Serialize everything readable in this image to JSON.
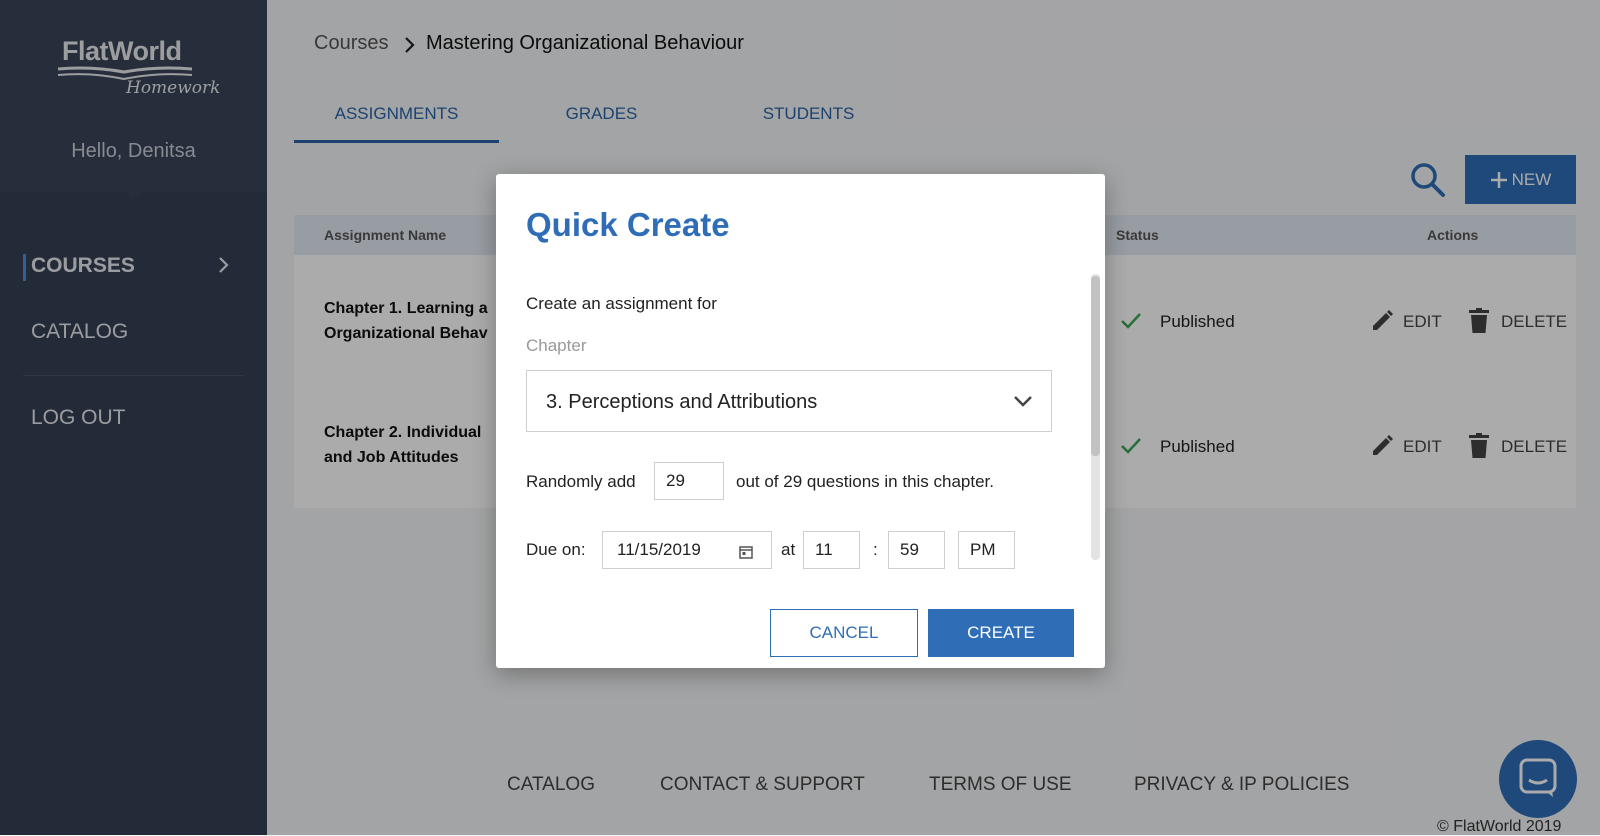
{
  "logo": {
    "name": "FlatWorld",
    "sub": "Homework"
  },
  "sidebar": {
    "greeting": "Hello, Denitsa",
    "items": [
      {
        "label": "COURSES",
        "active": true
      },
      {
        "label": "CATALOG"
      },
      {
        "label": "LOG OUT"
      }
    ]
  },
  "breadcrumb": {
    "root": "Courses",
    "current": "Mastering Organizational Behaviour"
  },
  "tabs": [
    {
      "label": "ASSIGNMENTS",
      "active": true
    },
    {
      "label": "GRADES"
    },
    {
      "label": "STUDENTS"
    }
  ],
  "toolbar": {
    "new_label": "NEW"
  },
  "table": {
    "headers": {
      "name": "Assignment Name",
      "status": "Status",
      "actions": "Actions"
    },
    "rows": [
      {
        "line1": "Chapter 1. Learning a",
        "line2": "Organizational Behav",
        "status": "Published",
        "edit": "EDIT",
        "delete": "DELETE"
      },
      {
        "line1": "Chapter 2. Individual",
        "line2": "and Job Attitudes",
        "status": "Published",
        "edit": "EDIT",
        "delete": "DELETE"
      }
    ]
  },
  "footer": {
    "links": [
      "CATALOG",
      "CONTACT & SUPPORT",
      "TERMS OF USE",
      "PRIVACY & IP POLICIES"
    ],
    "copyright": "© FlatWorld 2019"
  },
  "modal": {
    "title": "Quick Create",
    "intro": "Create an assignment for",
    "chapter_label": "Chapter",
    "chapter_value": "3. Perceptions and Attributions",
    "random_prefix": "Randomly add",
    "random_value": "29",
    "random_suffix": "out of 29 questions in this chapter.",
    "due_label": "Due on:",
    "due_date": "11/15/2019",
    "at_label": "at",
    "hour": "11",
    "colon": ":",
    "minute": "59",
    "ampm": "PM",
    "cancel_label": "CANCEL",
    "create_label": "CREATE"
  },
  "colors": {
    "accent": "#2f6eb7",
    "sidebar": "#353f54",
    "check": "#3aa655"
  }
}
